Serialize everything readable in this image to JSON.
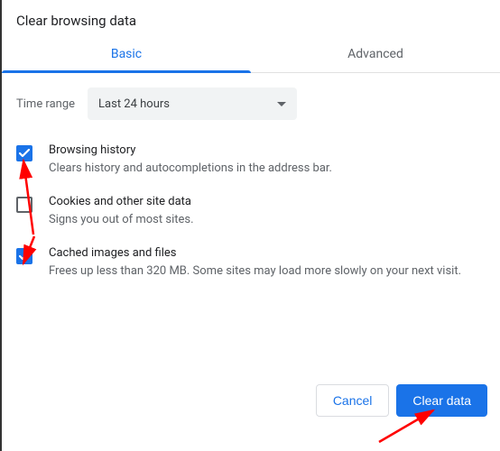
{
  "dialog": {
    "title": "Clear browsing data"
  },
  "tabs": {
    "basic": "Basic",
    "advanced": "Advanced",
    "active": "basic"
  },
  "time_range": {
    "label": "Time range",
    "value": "Last 24 hours"
  },
  "options": [
    {
      "id": "browsing-history",
      "title": "Browsing history",
      "description": "Clears history and autocompletions in the address bar.",
      "checked": true
    },
    {
      "id": "cookies",
      "title": "Cookies and other site data",
      "description": "Signs you out of most sites.",
      "checked": false
    },
    {
      "id": "cache",
      "title": "Cached images and files",
      "description": "Frees up less than 320 MB. Some sites may load more slowly on your next visit.",
      "checked": true
    }
  ],
  "buttons": {
    "cancel": "Cancel",
    "confirm": "Clear data"
  },
  "colors": {
    "accent": "#1a73e8",
    "annotation": "#ff0000"
  }
}
